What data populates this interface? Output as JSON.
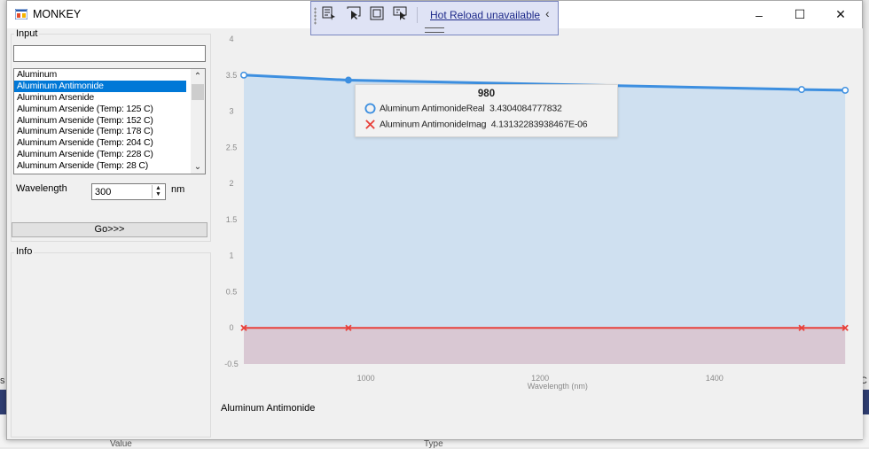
{
  "window": {
    "title": "MONKEY",
    "minimize_glyph": "–",
    "maximize_glyph": "☐",
    "close_glyph": "✕"
  },
  "hot_reload": {
    "link_text": "Hot Reload unavailable",
    "chevron": "‹",
    "icons": [
      "select-element-icon",
      "cursor-icon",
      "frame-icon",
      "track-focus-icon"
    ]
  },
  "background_app": {
    "left_edge_text": "s",
    "right_edge_text": "C",
    "col_value": "Value",
    "col_type": "Type"
  },
  "input_group": {
    "label": "Input",
    "search_value": "",
    "materials": [
      "Aluminum",
      "Aluminum Antimonide",
      "Aluminum Arsenide",
      "Aluminum Arsenide (Temp: 125 C)",
      "Aluminum Arsenide (Temp: 152 C)",
      "Aluminum Arsenide (Temp: 178 C)",
      "Aluminum Arsenide (Temp: 204 C)",
      "Aluminum Arsenide (Temp: 228 C)",
      "Aluminum Arsenide (Temp: 28 C)"
    ],
    "selected_index": 1,
    "wavelength_label": "Wavelength",
    "wavelength_value": "300",
    "wavelength_unit": "nm",
    "go_label": "Go>>>"
  },
  "info_group": {
    "label": "Info"
  },
  "chart_caption": "Aluminum Antimonide",
  "tooltip": {
    "title": "980",
    "rows": [
      {
        "series": "Aluminum AntimonideReal",
        "value": "3.4304084777832"
      },
      {
        "series": "Aluminum AntimonideImag",
        "value": "4.13132283938467E-06"
      }
    ]
  },
  "chart_data": {
    "type": "area",
    "xlabel": "Wavelength (nm)",
    "ylabel": "",
    "xlim": [
      860,
      1560
    ],
    "ylim": [
      -0.5,
      4
    ],
    "x_ticks": [
      1000,
      1200,
      1400
    ],
    "y_ticks": [
      "-0.5",
      "0",
      "0.5",
      "1",
      "1.5",
      "2",
      "2.5",
      "3",
      "3.5",
      "4"
    ],
    "grid": false,
    "colors": {
      "real": "#3d8fe0",
      "imag": "#e8403a",
      "real_fill": "#cfe0f0",
      "imag_fill": "#d9c8d3"
    },
    "series": [
      {
        "name": "Aluminum AntimonideReal",
        "marker": "circle",
        "x": [
          860,
          980,
          1500,
          1550
        ],
        "values": [
          3.5,
          3.43,
          3.3,
          3.29
        ]
      },
      {
        "name": "Aluminum AntimonideImag",
        "marker": "cross",
        "x": [
          860,
          980,
          1500,
          1550
        ],
        "values": [
          0,
          4.1e-06,
          0,
          0
        ]
      }
    ]
  }
}
